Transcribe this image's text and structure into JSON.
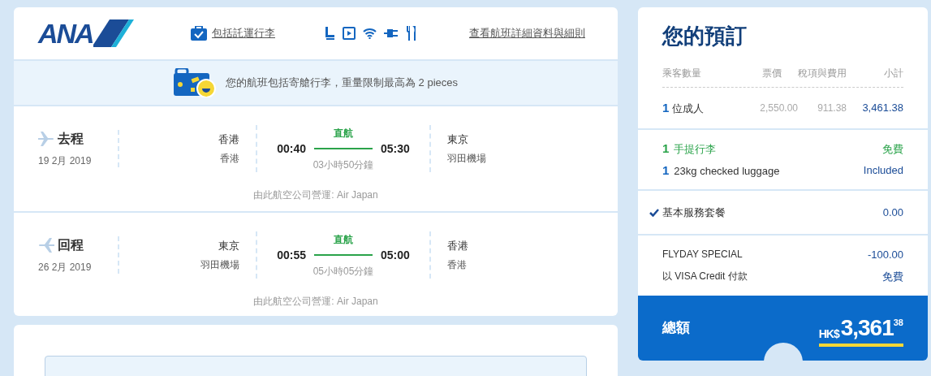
{
  "flight_card": {
    "logo": "ANA",
    "baggage_link": "包括託運行李",
    "details_link": "查看航班詳細資料與細則",
    "baggage_notice": "您的航班包括寄艙行李，重量限制最高為 2 pieces",
    "legs": [
      {
        "kind": "outbound",
        "title": "去程",
        "date": "19 2月 2019",
        "from_city": "香港",
        "from_airport": "香港",
        "depart": "00:40",
        "stops": "直航",
        "arrive": "05:30",
        "duration": "03小時50分鐘",
        "to_city": "東京",
        "to_airport": "羽田機場",
        "operator": "由此航空公司營運: Air Japan"
      },
      {
        "kind": "return",
        "title": "回程",
        "date": "26 2月 2019",
        "from_city": "東京",
        "from_airport": "羽田機場",
        "depart": "00:55",
        "stops": "直航",
        "arrive": "05:00",
        "duration": "05小時05分鐘",
        "to_city": "香港",
        "to_airport": "香港",
        "operator": "由此航空公司營運: Air Japan"
      }
    ]
  },
  "booking": {
    "title": "您的預訂",
    "columns": [
      "乘客數量",
      "票價",
      "稅項與費用",
      "小計"
    ],
    "passenger_row": {
      "count": "1",
      "label": "位成人",
      "fare": "2,550.00",
      "taxes": "911.38",
      "subtotal": "3,461.38"
    },
    "luggage": [
      {
        "count": "1",
        "label": "手提行李",
        "price": "免費",
        "kind": "cabin"
      },
      {
        "count": "1",
        "label": "23kg checked luggage",
        "price": "Included",
        "kind": "checked"
      }
    ],
    "package": {
      "label": "基本服務套餐",
      "price": "0.00",
      "checked": true
    },
    "discounts": [
      {
        "label": "FLYDAY SPECIAL",
        "value": "-100.00"
      },
      {
        "label": "以 VISA Credit 付款",
        "value": "免費"
      }
    ],
    "total": {
      "label": "總額",
      "currency": "HK$",
      "amount": "3,361",
      "cents": "38"
    }
  }
}
